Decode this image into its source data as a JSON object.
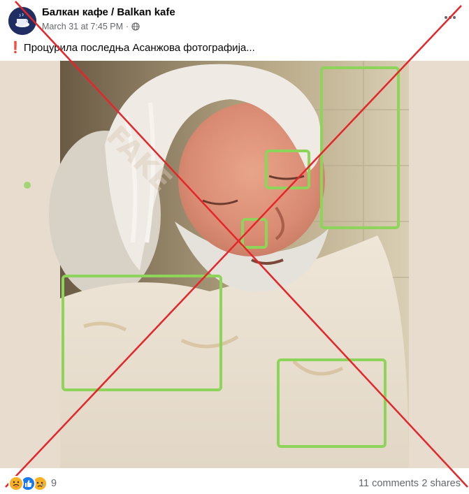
{
  "post": {
    "page_name": "Балкан кафе / Balkan kafe",
    "timestamp": "March 31 at 7:45 PM",
    "separator": "·",
    "privacy_icon": "globe-icon",
    "caption_prefix": "❗",
    "caption": "Процурила последња Асанжова фотографија...",
    "more_icon": "ellipsis-icon"
  },
  "image": {
    "overlay": "red-x-cross",
    "overlay_color": "#e4262b",
    "highlight_color": "#8ed45a",
    "watermark_color": "#d9c9b8"
  },
  "footer": {
    "reaction_icons": [
      "care-icon",
      "like-icon",
      "sad-icon"
    ],
    "reaction_count": "9",
    "comments": "11 comments",
    "shares": "2 shares"
  }
}
